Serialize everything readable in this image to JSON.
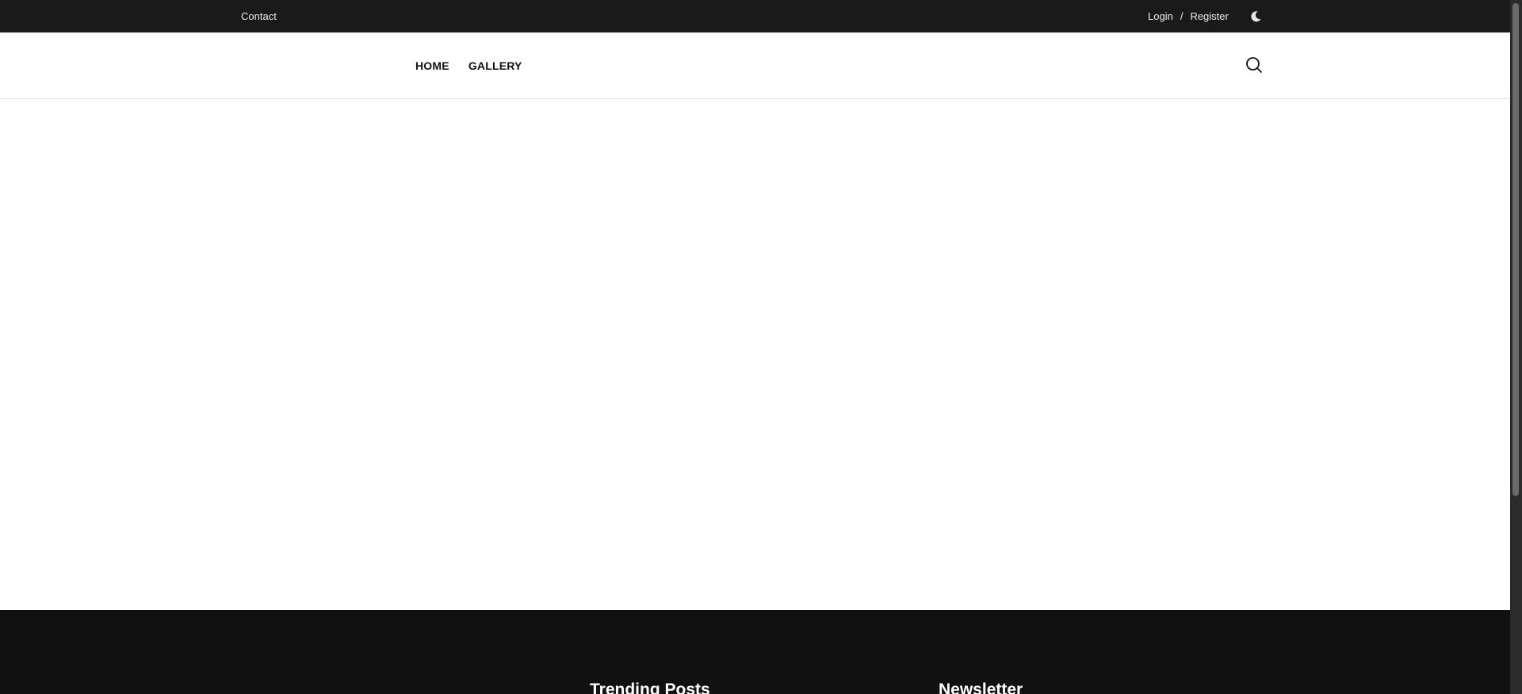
{
  "topbar": {
    "contact_label": "Contact",
    "login_label": "Login",
    "separator": "/",
    "register_label": "Register",
    "theme_icon": "moon-icon"
  },
  "header": {
    "nav_items": [
      {
        "label": "HOME"
      },
      {
        "label": "GALLERY"
      }
    ],
    "search_icon": "search-icon"
  },
  "footer": {
    "trending_title": "Trending Posts",
    "newsletter_title": "Newsletter"
  },
  "colors": {
    "topbar_bg": "#1a1a1a",
    "footer_bg": "#111111",
    "page_bg": "#ffffff"
  }
}
